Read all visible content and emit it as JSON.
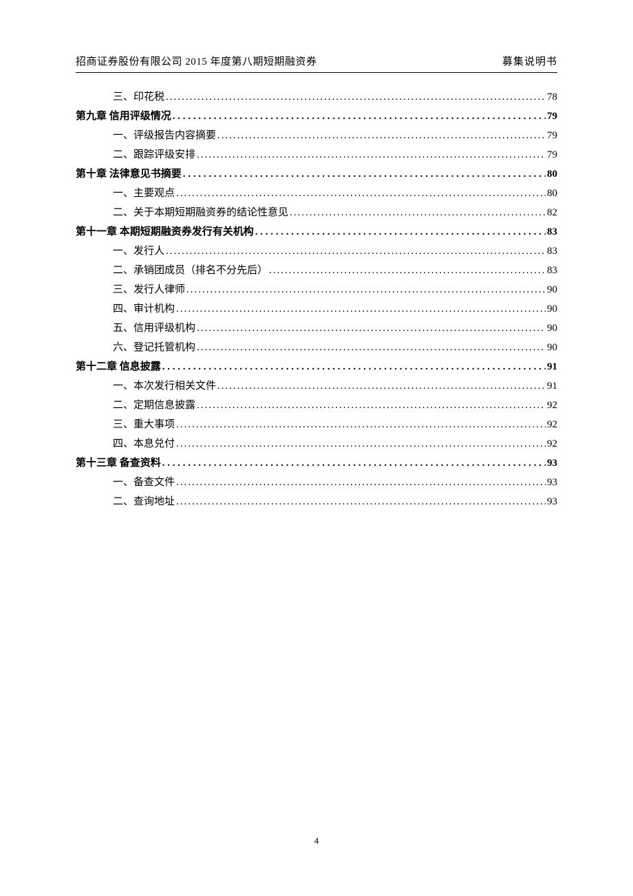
{
  "header": {
    "left": "招商证券股份有限公司 2015 年度第八期短期融资券",
    "right": "募集说明书"
  },
  "toc": [
    {
      "level": "sub",
      "label": "三、印花税",
      "page": "78"
    },
    {
      "level": "chapter",
      "label": "第九章  信用评级情况",
      "page": "79"
    },
    {
      "level": "sub",
      "label": "一、评级报告内容摘要",
      "page": "79"
    },
    {
      "level": "sub",
      "label": "二、跟踪评级安排",
      "page": "79"
    },
    {
      "level": "chapter",
      "label": "第十章  法律意见书摘要",
      "page": "80"
    },
    {
      "level": "sub",
      "label": "一、主要观点",
      "page": "80"
    },
    {
      "level": "sub",
      "label": "二、关于本期短期融资券的结论性意见",
      "page": "82"
    },
    {
      "level": "chapter",
      "label": "第十一章  本期短期融资券发行有关机构",
      "page": "83"
    },
    {
      "level": "sub",
      "label": "一、发行人",
      "page": "83"
    },
    {
      "level": "sub",
      "label": "二、承销团成员（排名不分先后）",
      "page": "83"
    },
    {
      "level": "sub",
      "label": "三、发行人律师",
      "page": "90"
    },
    {
      "level": "sub",
      "label": "四、审计机构",
      "page": "90"
    },
    {
      "level": "sub",
      "label": "五、信用评级机构",
      "page": "90"
    },
    {
      "level": "sub",
      "label": "六、登记托管机构",
      "page": "90"
    },
    {
      "level": "chapter",
      "label": "第十二章  信息披露",
      "page": "91"
    },
    {
      "level": "sub",
      "label": "一、本次发行相关文件",
      "page": "91"
    },
    {
      "level": "sub",
      "label": "二、定期信息披露",
      "page": "92"
    },
    {
      "level": "sub",
      "label": "三、重大事项",
      "page": "92"
    },
    {
      "level": "sub",
      "label": "四、本息兑付",
      "page": "92"
    },
    {
      "level": "chapter",
      "label": "第十三章  备查资料",
      "page": "93"
    },
    {
      "level": "sub",
      "label": "一、备查文件",
      "page": "93"
    },
    {
      "level": "sub",
      "label": "二、查询地址",
      "page": "93"
    }
  ],
  "footer": {
    "page_number": "4"
  },
  "dots": {
    "chapter": " . . . . . . . . . . . . . . . . . . . . . . . . . . . . . . . . . . . . . . . . . . . . . . . . . . . . . . . . . . . . . . . . . . . . . . . . . . . . . . . . . . . . . . . . . . . . . . . . . .",
    "sub": "........................................................................................................................................................................................................"
  }
}
